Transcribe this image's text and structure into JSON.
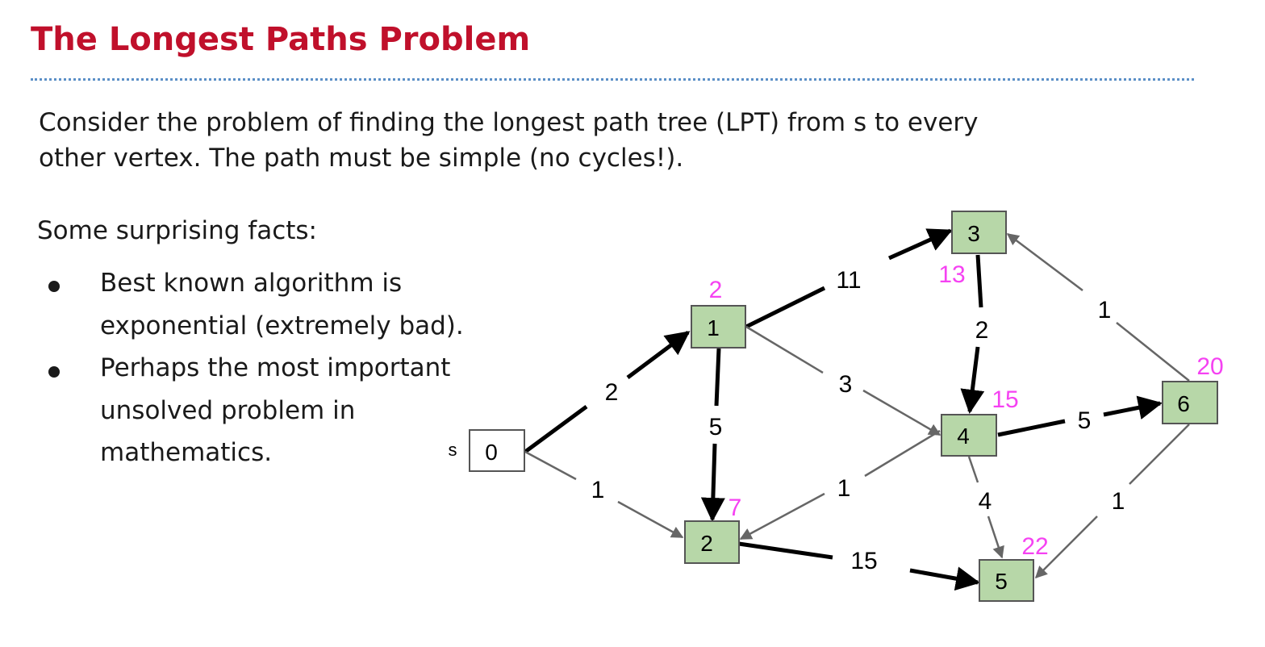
{
  "slide": {
    "title": "The Longest Paths Problem",
    "intro_lines": [
      "Consider the problem of finding the longest path tree (LPT) from s to every",
      "other vertex. The path must be simple (no cycles!)."
    ],
    "facts_heading": "Some surprising facts:",
    "bullets": [
      [
        "Best known algorithm is",
        "exponential (extremely bad)."
      ],
      [
        "Perhaps the most important",
        "unsolved problem in",
        "mathematics."
      ]
    ]
  },
  "graph": {
    "source_label": "s",
    "colors": {
      "tree_node_fill": "#b7d7a8",
      "source_node_fill": "#ffffff",
      "tree_edge": "#000000",
      "other_edge": "#666666",
      "distance_label": "#f542f2",
      "title": "#c0102b",
      "divider": "#5b8fc7"
    },
    "nodes": [
      {
        "id": 0,
        "label": "0",
        "distance": null,
        "source": true
      },
      {
        "id": 1,
        "label": "1",
        "distance": "2"
      },
      {
        "id": 2,
        "label": "2",
        "distance": "7"
      },
      {
        "id": 3,
        "label": "3",
        "distance": "13"
      },
      {
        "id": 4,
        "label": "4",
        "distance": "15"
      },
      {
        "id": 5,
        "label": "5",
        "distance": "22"
      },
      {
        "id": 6,
        "label": "6",
        "distance": "20"
      }
    ],
    "edges": [
      {
        "from": 0,
        "to": 1,
        "weight": "2",
        "in_tree": true
      },
      {
        "from": 0,
        "to": 2,
        "weight": "1",
        "in_tree": false
      },
      {
        "from": 1,
        "to": 3,
        "weight": "11",
        "in_tree": true
      },
      {
        "from": 1,
        "to": 2,
        "weight": "5",
        "in_tree": true
      },
      {
        "from": 1,
        "to": 4,
        "weight": "3",
        "in_tree": false
      },
      {
        "from": 3,
        "to": 4,
        "weight": "2",
        "in_tree": true
      },
      {
        "from": 4,
        "to": 2,
        "weight": "1",
        "in_tree": false
      },
      {
        "from": 2,
        "to": 5,
        "weight": "15",
        "in_tree": true
      },
      {
        "from": 4,
        "to": 5,
        "weight": "4",
        "in_tree": false
      },
      {
        "from": 4,
        "to": 6,
        "weight": "5",
        "in_tree": true
      },
      {
        "from": 6,
        "to": 3,
        "weight": "1",
        "in_tree": false
      },
      {
        "from": 6,
        "to": 5,
        "weight": "1",
        "in_tree": false
      }
    ]
  }
}
